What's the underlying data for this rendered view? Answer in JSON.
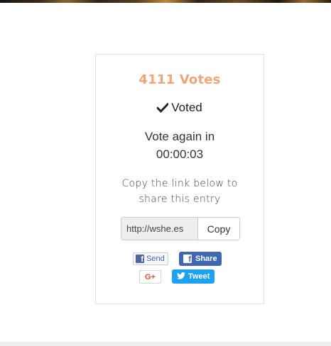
{
  "colors": {
    "votes_accent": "#f0a47a",
    "facebook_blue": "#4267b2",
    "twitter_blue": "#1da1f2",
    "google_red": "#dd4b39"
  },
  "vote_card": {
    "votes_label": "4111 Votes",
    "voted_icon": "checkmark-icon",
    "voted_label": "Voted",
    "vote_again_label": "Vote again in",
    "countdown": "00:00:03",
    "share_line1": "Copy the link below to",
    "share_line2": "share this entry",
    "link_value": "http://wshe.es",
    "copy_label": "Copy"
  },
  "social": {
    "fb_send_icon": "facebook-icon",
    "fb_send_label": "Send",
    "fb_share_icon": "facebook-icon",
    "fb_share_label": "Share",
    "gplus_label": "G+",
    "tweet_icon": "twitter-bird-icon",
    "tweet_label": "Tweet"
  }
}
